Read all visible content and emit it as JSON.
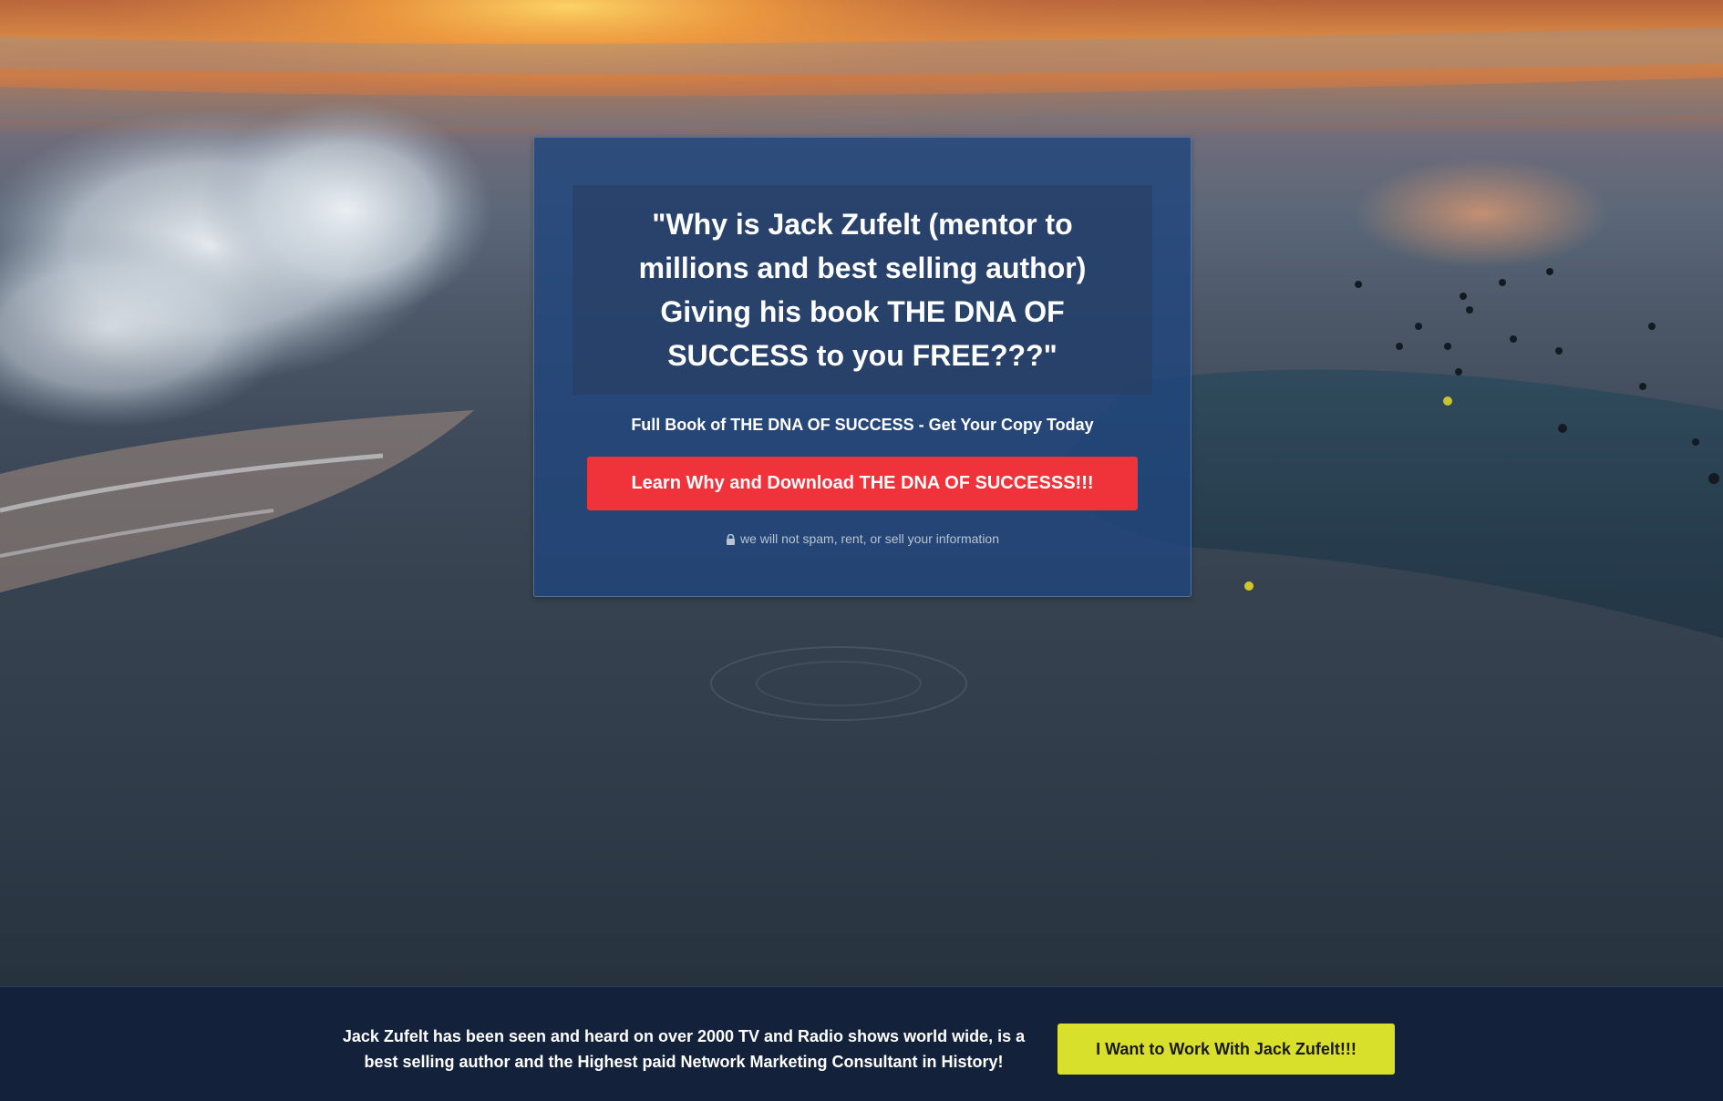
{
  "hero": {
    "background_icon": "ocean-sunset-image"
  },
  "optin": {
    "headline": "\"Why is Jack Zufelt (mentor to millions and best selling author) Giving his book THE DNA OF SUCCESS to you FREE???\"",
    "subhead": "Full Book of THE DNA OF SUCCESS - Get Your Copy Today",
    "cta_label": "Learn Why and Download THE DNA OF SUCCESSS!!!",
    "privacy_icon": "lock-icon",
    "privacy_text": "we will not spam, rent, or sell your information"
  },
  "footer": {
    "text": "Jack Zufelt has been seen and heard on over 2000 TV and Radio shows world wide, is a best selling author and the Highest paid Network Marketing Consultant in History!",
    "button_label": "I Want to Work With Jack Zufelt!!!"
  },
  "colors": {
    "card_bg": "#20467d",
    "cta_bg": "#f0323a",
    "footer_bg": "#13223a",
    "work_button_bg": "#d9e02b"
  }
}
